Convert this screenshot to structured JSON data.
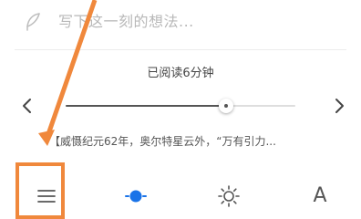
{
  "note": {
    "placeholder": "写下这一刻的想法...",
    "icon": "feather-icon"
  },
  "progress": {
    "label": "已阅读6分钟",
    "fraction": 0.7
  },
  "chapter": {
    "text": "【威慑纪元62年，奥尔特星云外，“万有引力..."
  },
  "toolbar": {
    "items": [
      {
        "name": "menu",
        "icon": "menu-icon"
      },
      {
        "name": "night",
        "icon": "night-mode-icon",
        "color": "#1a73e8"
      },
      {
        "name": "brightness",
        "icon": "brightness-icon"
      },
      {
        "name": "font",
        "icon": "font-icon",
        "glyph": "A"
      }
    ]
  },
  "colors": {
    "accent": "#1a73e8",
    "annotation": "#f0883c"
  }
}
